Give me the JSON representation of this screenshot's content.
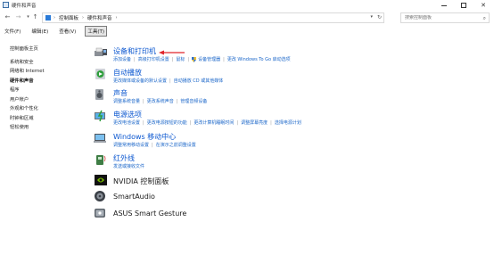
{
  "window": {
    "title": "硬件和声音"
  },
  "address": {
    "crumbs": [
      "控制面板",
      "硬件和声音"
    ],
    "search_placeholder": "搜索控制面板"
  },
  "menu": {
    "items": [
      "文件(F)",
      "编辑(E)",
      "查看(V)",
      "工具(T)"
    ]
  },
  "sidebar": {
    "items": [
      "控制面板主页",
      "系统和安全",
      "网络和 Internet",
      "硬件和声音",
      "程序",
      "用户帐户",
      "外观和个性化",
      "时钟和区域",
      "轻松使用"
    ],
    "current_index": 3
  },
  "categories": [
    {
      "heading": "设备和打印机",
      "icon": "printer-icon",
      "links": [
        "添加设备",
        "高级打印机设置",
        "鼠标",
        "设备管理器",
        "更改 Windows To Go 启动选项"
      ]
    },
    {
      "heading": "自动播放",
      "icon": "autoplay-icon",
      "links": [
        "更改媒体或设备的默认设置",
        "自动播放 CD 或其他媒体"
      ]
    },
    {
      "heading": "声音",
      "icon": "speaker-icon",
      "links": [
        "调整系统音量",
        "更改系统声音",
        "管理音频设备"
      ]
    },
    {
      "heading": "电源选项",
      "icon": "power-options-icon",
      "links": [
        "更改电池设置",
        "更改电源按钮的功能",
        "更改计算机睡眠时间",
        "调整屏幕亮度",
        "选择电源计划"
      ]
    },
    {
      "heading": "Windows 移动中心",
      "icon": "mobility-center-icon",
      "links": [
        "调整常用移动设置",
        "在演示之前调整设置"
      ]
    },
    {
      "heading": "红外线",
      "icon": "infrared-icon",
      "links": [
        "发送或接收文件"
      ]
    },
    {
      "heading": "NVIDIA 控制面板",
      "icon": "nvidia-icon",
      "links": []
    },
    {
      "heading": "SmartAudio",
      "icon": "smartaudio-icon",
      "links": []
    },
    {
      "heading": "ASUS Smart Gesture",
      "icon": "asus-gesture-icon",
      "links": []
    }
  ],
  "colors": {
    "link": "#1a66c9",
    "heading": "#0b57d0",
    "annotation_arrow": "#e0252b"
  }
}
